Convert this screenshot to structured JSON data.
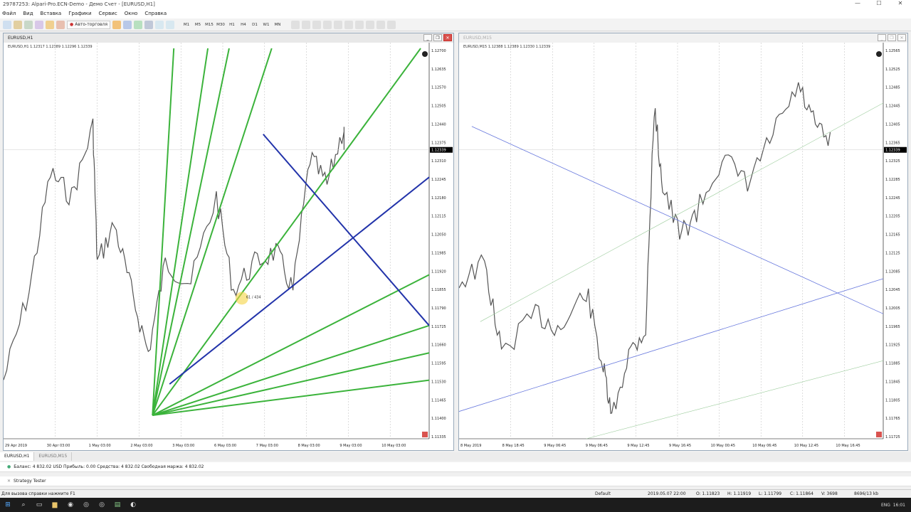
{
  "window": {
    "title": "29787253: Alpari-Pro.ECN-Demo - Демо Счет - [EURUSD,H1]"
  },
  "menu": [
    "Файл",
    "Вид",
    "Вставка",
    "Графики",
    "Сервис",
    "Окно",
    "Справка"
  ],
  "toolbar": {
    "autotrade_label": "Авто-торговля",
    "timeframes": [
      "M1",
      "M5",
      "M15",
      "M30",
      "H1",
      "H4",
      "D1",
      "W1",
      "MN"
    ]
  },
  "chart_left": {
    "title": "EURUSD,H1",
    "info": "EURUSD,H1  1.12317  1.12389  1.12296  1.12339",
    "price_labels": [
      "1.12700",
      "1.12635",
      "1.12570",
      "1.12505",
      "1.12440",
      "1.12375",
      "1.12310",
      "1.12245",
      "1.12180",
      "1.12115",
      "1.12050",
      "1.11985",
      "1.11920",
      "1.11855",
      "1.11790",
      "1.11725",
      "1.11660",
      "1.11595",
      "1.11530",
      "1.11465",
      "1.11400",
      "1.11335"
    ],
    "current_price": "1.12339",
    "time_labels": [
      "29 Apr 2019",
      "30 Apr 03:00",
      "1 May 03:00",
      "2 May 03:00",
      "3 May 03:00",
      "6 May 03:00",
      "7 May 03:00",
      "8 May 03:00",
      "9 May 03:00",
      "10 May 03:00"
    ],
    "cursor_label": "61 / 434"
  },
  "chart_right": {
    "title": "EURUSD,M15",
    "info": "EURUSD,M15  1.12388  1.12389  1.12330  1.12339",
    "price_labels": [
      "1.12565",
      "1.12525",
      "1.12485",
      "1.12445",
      "1.12405",
      "1.12365",
      "1.12325",
      "1.12285",
      "1.12245",
      "1.12205",
      "1.12165",
      "1.12125",
      "1.12085",
      "1.12045",
      "1.12005",
      "1.11965",
      "1.11925",
      "1.11885",
      "1.11845",
      "1.11805",
      "1.11765",
      "1.11725"
    ],
    "current_price": "1.12339",
    "time_labels": [
      "8 May 2019",
      "8 May 18:45",
      "9 May 06:45",
      "9 May 06:45",
      "9 May 12:45",
      "9 May 16:45",
      "10 May 00:45",
      "10 May 06:45",
      "10 May 12:45",
      "10 May 16:45"
    ]
  },
  "tabs": [
    "EURUSD,H1",
    "EURUSD,M15"
  ],
  "terminal": {
    "balance_line": "Баланс: 4 832.02 USD  Прибыль: 0.00  Средства: 4 832.02  Свободная маржа: 4 832.02",
    "tester": "Strategy Tester"
  },
  "status": {
    "help": "Для вызова справки нажмите F1",
    "profile": "Default",
    "datetime": "2019.05.07 22:00",
    "open": "O: 1.11823",
    "high": "H: 1.11919",
    "low": "L: 1.11799",
    "close": "C: 1.11864",
    "volume": "V: 3698",
    "traffic": "8696/13 kb"
  },
  "tray": {
    "lang": "ENG",
    "time": "16:01"
  }
}
